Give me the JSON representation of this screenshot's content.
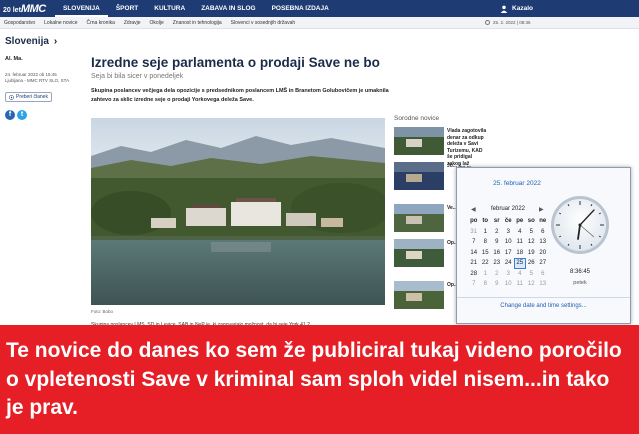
{
  "topnav": {
    "logo_number": "20 let",
    "logo_brand": "MMC",
    "items": [
      "SLOVENIJA",
      "ŠPORT",
      "KULTURA",
      "ZABAVA IN SLOG",
      "POSEBNA IZDAJA"
    ],
    "active_index": 0,
    "login_label": "Kazalo"
  },
  "subnav": {
    "items": [
      "Gospodarstvo",
      "Lokalne novice",
      "Črna kronika",
      "Zdravje",
      "Okolje",
      "Znanost in tehnologija",
      "Slovenci v sosednjih državah"
    ],
    "date": "25. 2. 2022 | 08:36"
  },
  "section": {
    "title": "Slovenija",
    "chevron": "›"
  },
  "meta": {
    "author": "Al. Ma.",
    "date": "24. februar 2022 ob 15:45",
    "source": "Ljubljana - MMC RTV SLO, STA",
    "listen_label": "Preberi članek"
  },
  "article": {
    "headline": "Izredne seje parlamenta o prodaji Save ne bo",
    "subhead": "Seja bi bila sicer v ponedeljek",
    "lead": "Skupina poslancev večjega dela opozicije s predsednikom poslancem LMŠ in Branetom Golubovičem je umaknila zahtevo za sklic izredne seje o prodaji Yorkovega deleža Save.",
    "caption": "Foto: Bobo",
    "body_start": "Skupina poslancev LMŠ, SD in Levice, SAB in NeP je, ki zagovarjajo možnost, da bi seje York 41 2"
  },
  "related": {
    "title": "Sorodne novice",
    "items": [
      {
        "text": "Vlada zagotovila denar za odkup deleža v Savi Turizemu, KAD še pridigal zakon laž"
      },
      {
        "text": "Jo... k... ..."
      },
      {
        "text": "Ve... u... ..."
      },
      {
        "text": "Op... u... ..."
      },
      {
        "text": "Op... ..."
      }
    ]
  },
  "calendar": {
    "header_date": "25. februar 2022",
    "month_label": "februar 2022",
    "prev": "◀",
    "next": "▶",
    "weekdays": [
      "po",
      "to",
      "sr",
      "če",
      "pe",
      "so",
      "ne"
    ],
    "weeks": [
      [
        "31",
        "1",
        "2",
        "3",
        "4",
        "5",
        "6"
      ],
      [
        "7",
        "8",
        "9",
        "10",
        "11",
        "12",
        "13"
      ],
      [
        "14",
        "15",
        "16",
        "17",
        "18",
        "19",
        "20"
      ],
      [
        "21",
        "22",
        "23",
        "24",
        "25",
        "26",
        "27"
      ],
      [
        "28",
        "1",
        "2",
        "3",
        "4",
        "5",
        "6"
      ],
      [
        "7",
        "8",
        "9",
        "10",
        "11",
        "12",
        "13"
      ]
    ],
    "today": "25",
    "time": "8:36:45",
    "weekday_name": "petek",
    "change_link": "Change date and time settings..."
  },
  "banner": {
    "text": "Te novice do danes ko sem že publiciral tukaj videno poročilo o vpletenosti Save v kriminal sam sploh videl nisem...in tako je prav."
  },
  "colors": {
    "nav_blue": "#1e3c73",
    "banner_red": "#e61e26",
    "link_blue": "#1e5fb4"
  }
}
